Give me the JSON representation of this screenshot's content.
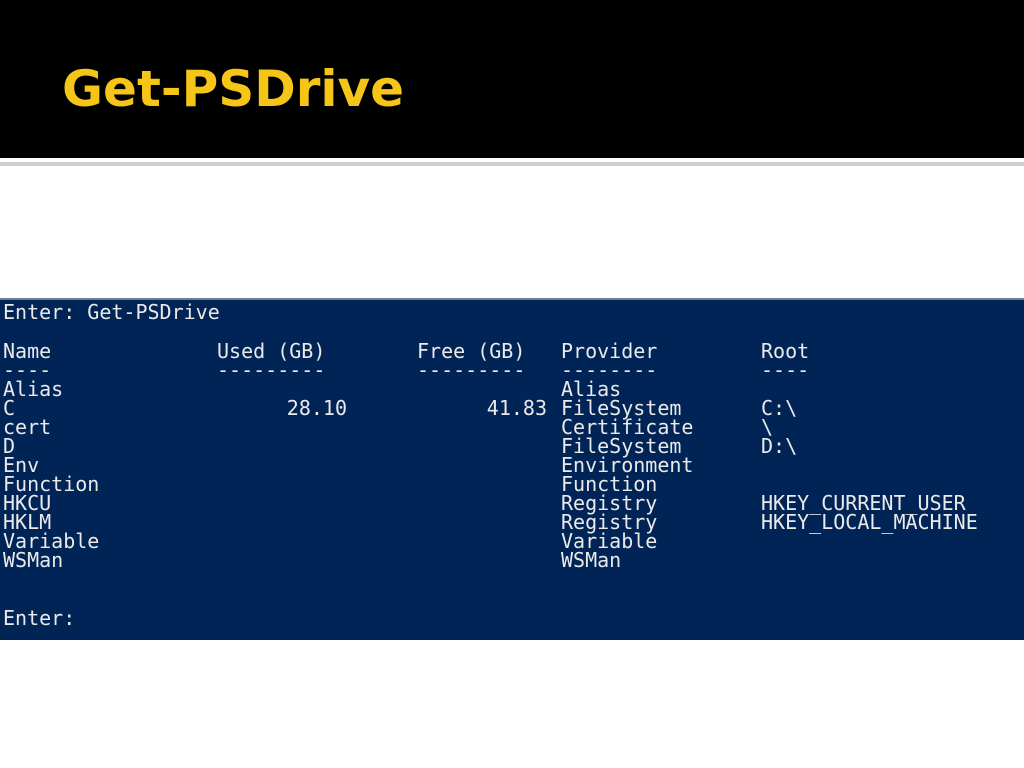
{
  "slide": {
    "title": "Get-PSDrive",
    "title_color": "#f5c518",
    "header_background": "#000000"
  },
  "console": {
    "background": "#012456",
    "text_color": "#eaeaea",
    "command_line": "Enter: Get-PSDrive",
    "headers": {
      "name": "Name",
      "used": "Used (GB)",
      "free": "Free (GB)",
      "provider": "Provider",
      "root": "Root"
    },
    "separators": {
      "name": "----",
      "used": "---------",
      "free": "---------",
      "provider": "--------",
      "root": "----"
    },
    "rows": [
      {
        "name": "Alias",
        "used": "",
        "free": "",
        "provider": "Alias",
        "root": ""
      },
      {
        "name": "C",
        "used": "28.10",
        "free": "41.83",
        "provider": "FileSystem",
        "root": "C:\\"
      },
      {
        "name": "cert",
        "used": "",
        "free": "",
        "provider": "Certificate",
        "root": "\\"
      },
      {
        "name": "D",
        "used": "",
        "free": "",
        "provider": "FileSystem",
        "root": "D:\\"
      },
      {
        "name": "Env",
        "used": "",
        "free": "",
        "provider": "Environment",
        "root": ""
      },
      {
        "name": "Function",
        "used": "",
        "free": "",
        "provider": "Function",
        "root": ""
      },
      {
        "name": "HKCU",
        "used": "",
        "free": "",
        "provider": "Registry",
        "root": "HKEY_CURRENT_USER"
      },
      {
        "name": "HKLM",
        "used": "",
        "free": "",
        "provider": "Registry",
        "root": "HKEY_LOCAL_MACHINE"
      },
      {
        "name": "Variable",
        "used": "",
        "free": "",
        "provider": "Variable",
        "root": ""
      },
      {
        "name": "WSMan",
        "used": "",
        "free": "",
        "provider": "WSMan",
        "root": ""
      }
    ],
    "prompt_line": "Enter:"
  }
}
